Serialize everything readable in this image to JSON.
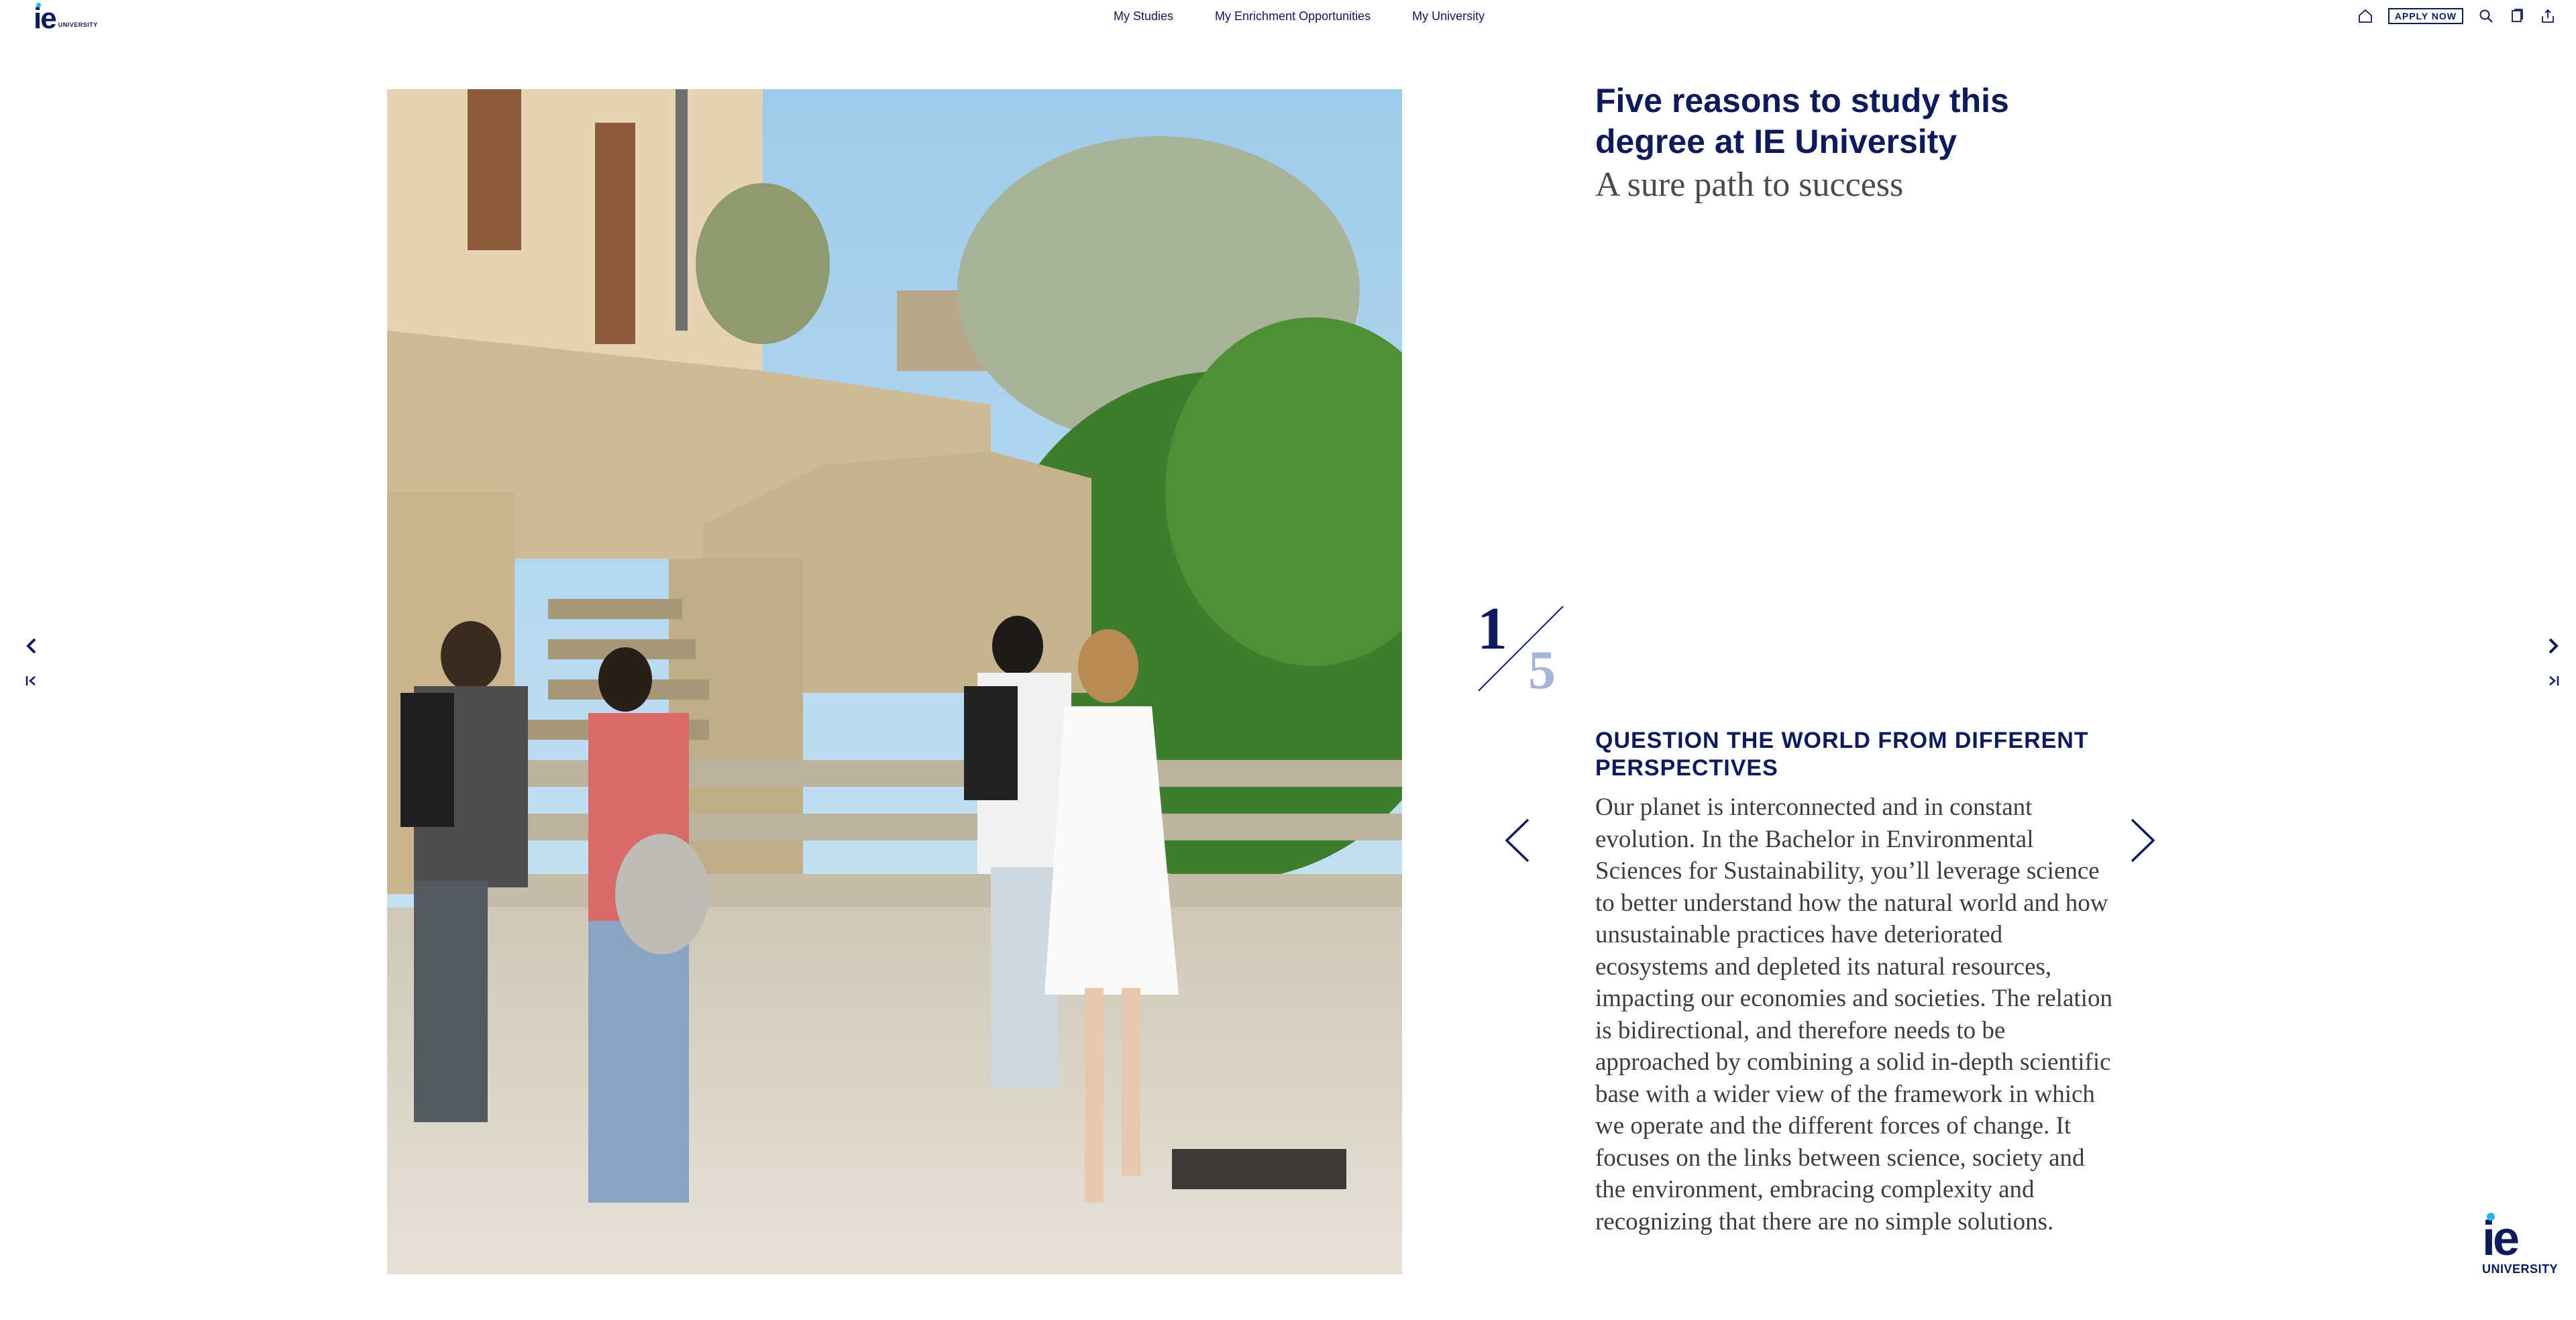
{
  "header": {
    "logo_main": "ie",
    "logo_sub": "UNIVERSITY",
    "nav": [
      "My Studies",
      "My Enrichment Opportunities",
      "My University"
    ],
    "apply_label": "APPLY NOW",
    "icons": [
      "home-icon",
      "search-icon",
      "bookmark-icon",
      "share-icon"
    ]
  },
  "headline": {
    "title": "Five reasons to study this degree at IE University",
    "subtitle": "A sure path to success"
  },
  "counter": {
    "current": "1",
    "total": "5"
  },
  "reason": {
    "heading": "QUESTION THE WORLD FROM DIFFERENT PERSPECTIVES",
    "body": "Our planet is interconnected and in constant evolution. In the Bachelor in Environmental Sciences for Sustainability, you’ll leverage science to better understand how the natural world and how unsustainable practices have deteriorated ecosystems and depleted its natural resources, impacting our economies and societies. The relation is bidirectional, and therefore needs to be approached by combining a solid in-depth scientific base with a wider view of the framework in which we operate and the different forces of change. It focuses on the links between science, society and the environment, embracing complexity and recognizing that there are no simple solutions."
  },
  "footer_logo": {
    "main": "ie",
    "sub": "UNIVERSITY"
  },
  "colors": {
    "brand_navy": "#0d1a5c",
    "accent_blue": "#2bb3e8",
    "counter_light": "#a7b4d8"
  }
}
